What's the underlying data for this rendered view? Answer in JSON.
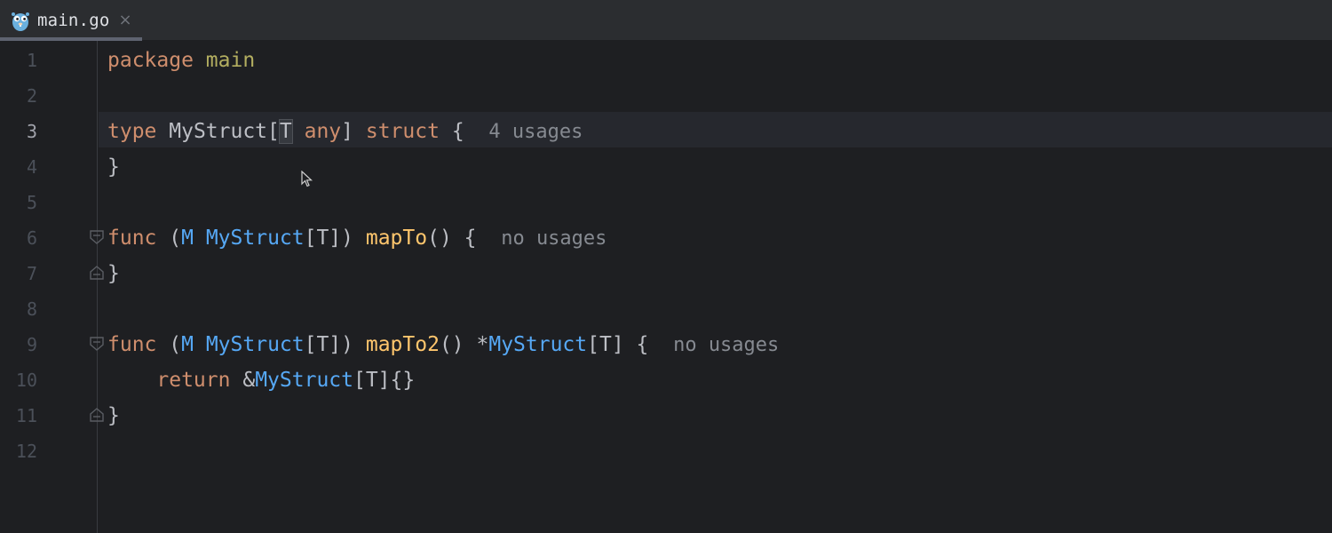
{
  "tab": {
    "filename": "main.go",
    "close_glyph": "×",
    "icon": "gopher-icon"
  },
  "gutter": {
    "line_numbers": [
      "1",
      "2",
      "3",
      "4",
      "5",
      "6",
      "7",
      "8",
      "9",
      "10",
      "11",
      "12"
    ],
    "active_line": "3"
  },
  "code": {
    "l1": {
      "kw": "package",
      "name": "main"
    },
    "l3": {
      "kw1": "type",
      "name": "MyStruct",
      "open": "[",
      "tp": "T",
      "sp": " ",
      "constraint": "any",
      "close": "]",
      "kw2": "struct",
      "brace": "{",
      "hint": "4 usages"
    },
    "l4": {
      "brace": "}"
    },
    "l6": {
      "kw": "func",
      "p1": "(",
      "recv": "M",
      "type": "MyStruct",
      "gen": "[T])",
      "fn": "mapTo",
      "rest": "() {",
      "hint": "no usages"
    },
    "l7": {
      "brace": "}"
    },
    "l9": {
      "kw": "func",
      "p1": "(",
      "recv": "M",
      "type": "MyStruct",
      "gen": "[T])",
      "fn": "mapTo2",
      "p2": "() *",
      "rtype": "MyStruct",
      "rest": "[T] {",
      "hint": "no usages"
    },
    "l10": {
      "kw": "return",
      "amp": "&",
      "type": "MyStruct",
      "rest": "[T]{}"
    },
    "l11": {
      "brace": "}"
    }
  },
  "colors": {
    "keyword": "#cf8e6d",
    "function": "#ffc66d",
    "type_ref": "#56a8f5",
    "hint": "#868a91",
    "background": "#1e1f22"
  }
}
